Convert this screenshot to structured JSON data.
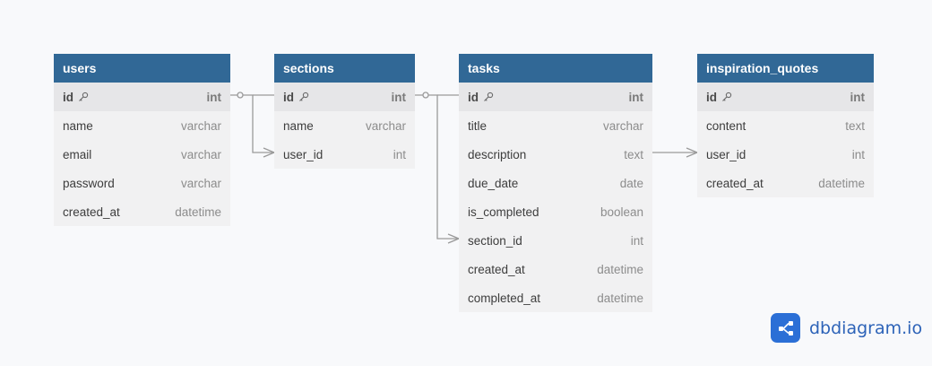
{
  "tables": {
    "users": {
      "name": "users",
      "fields": [
        {
          "name": "id",
          "type": "int"
        },
        {
          "name": "name",
          "type": "varchar"
        },
        {
          "name": "email",
          "type": "varchar"
        },
        {
          "name": "password",
          "type": "varchar"
        },
        {
          "name": "created_at",
          "type": "datetime"
        }
      ]
    },
    "sections": {
      "name": "sections",
      "fields": [
        {
          "name": "id",
          "type": "int"
        },
        {
          "name": "name",
          "type": "varchar"
        },
        {
          "name": "user_id",
          "type": "int"
        }
      ]
    },
    "tasks": {
      "name": "tasks",
      "fields": [
        {
          "name": "id",
          "type": "int"
        },
        {
          "name": "title",
          "type": "varchar"
        },
        {
          "name": "description",
          "type": "text"
        },
        {
          "name": "due_date",
          "type": "date"
        },
        {
          "name": "is_completed",
          "type": "boolean"
        },
        {
          "name": "section_id",
          "type": "int"
        },
        {
          "name": "created_at",
          "type": "datetime"
        },
        {
          "name": "completed_at",
          "type": "datetime"
        }
      ]
    },
    "inspiration_quotes": {
      "name": "inspiration_quotes",
      "fields": [
        {
          "name": "id",
          "type": "int"
        },
        {
          "name": "content",
          "type": "text"
        },
        {
          "name": "user_id",
          "type": "int"
        },
        {
          "name": "created_at",
          "type": "datetime"
        }
      ]
    }
  },
  "brand": {
    "text": "dbdiagram.io"
  },
  "colors": {
    "header": "#316896",
    "brand": "#2b6fd6",
    "connector": "#9a9a9a"
  },
  "icons": {
    "primary_key": "key-icon",
    "logo": "share-nodes-icon"
  }
}
